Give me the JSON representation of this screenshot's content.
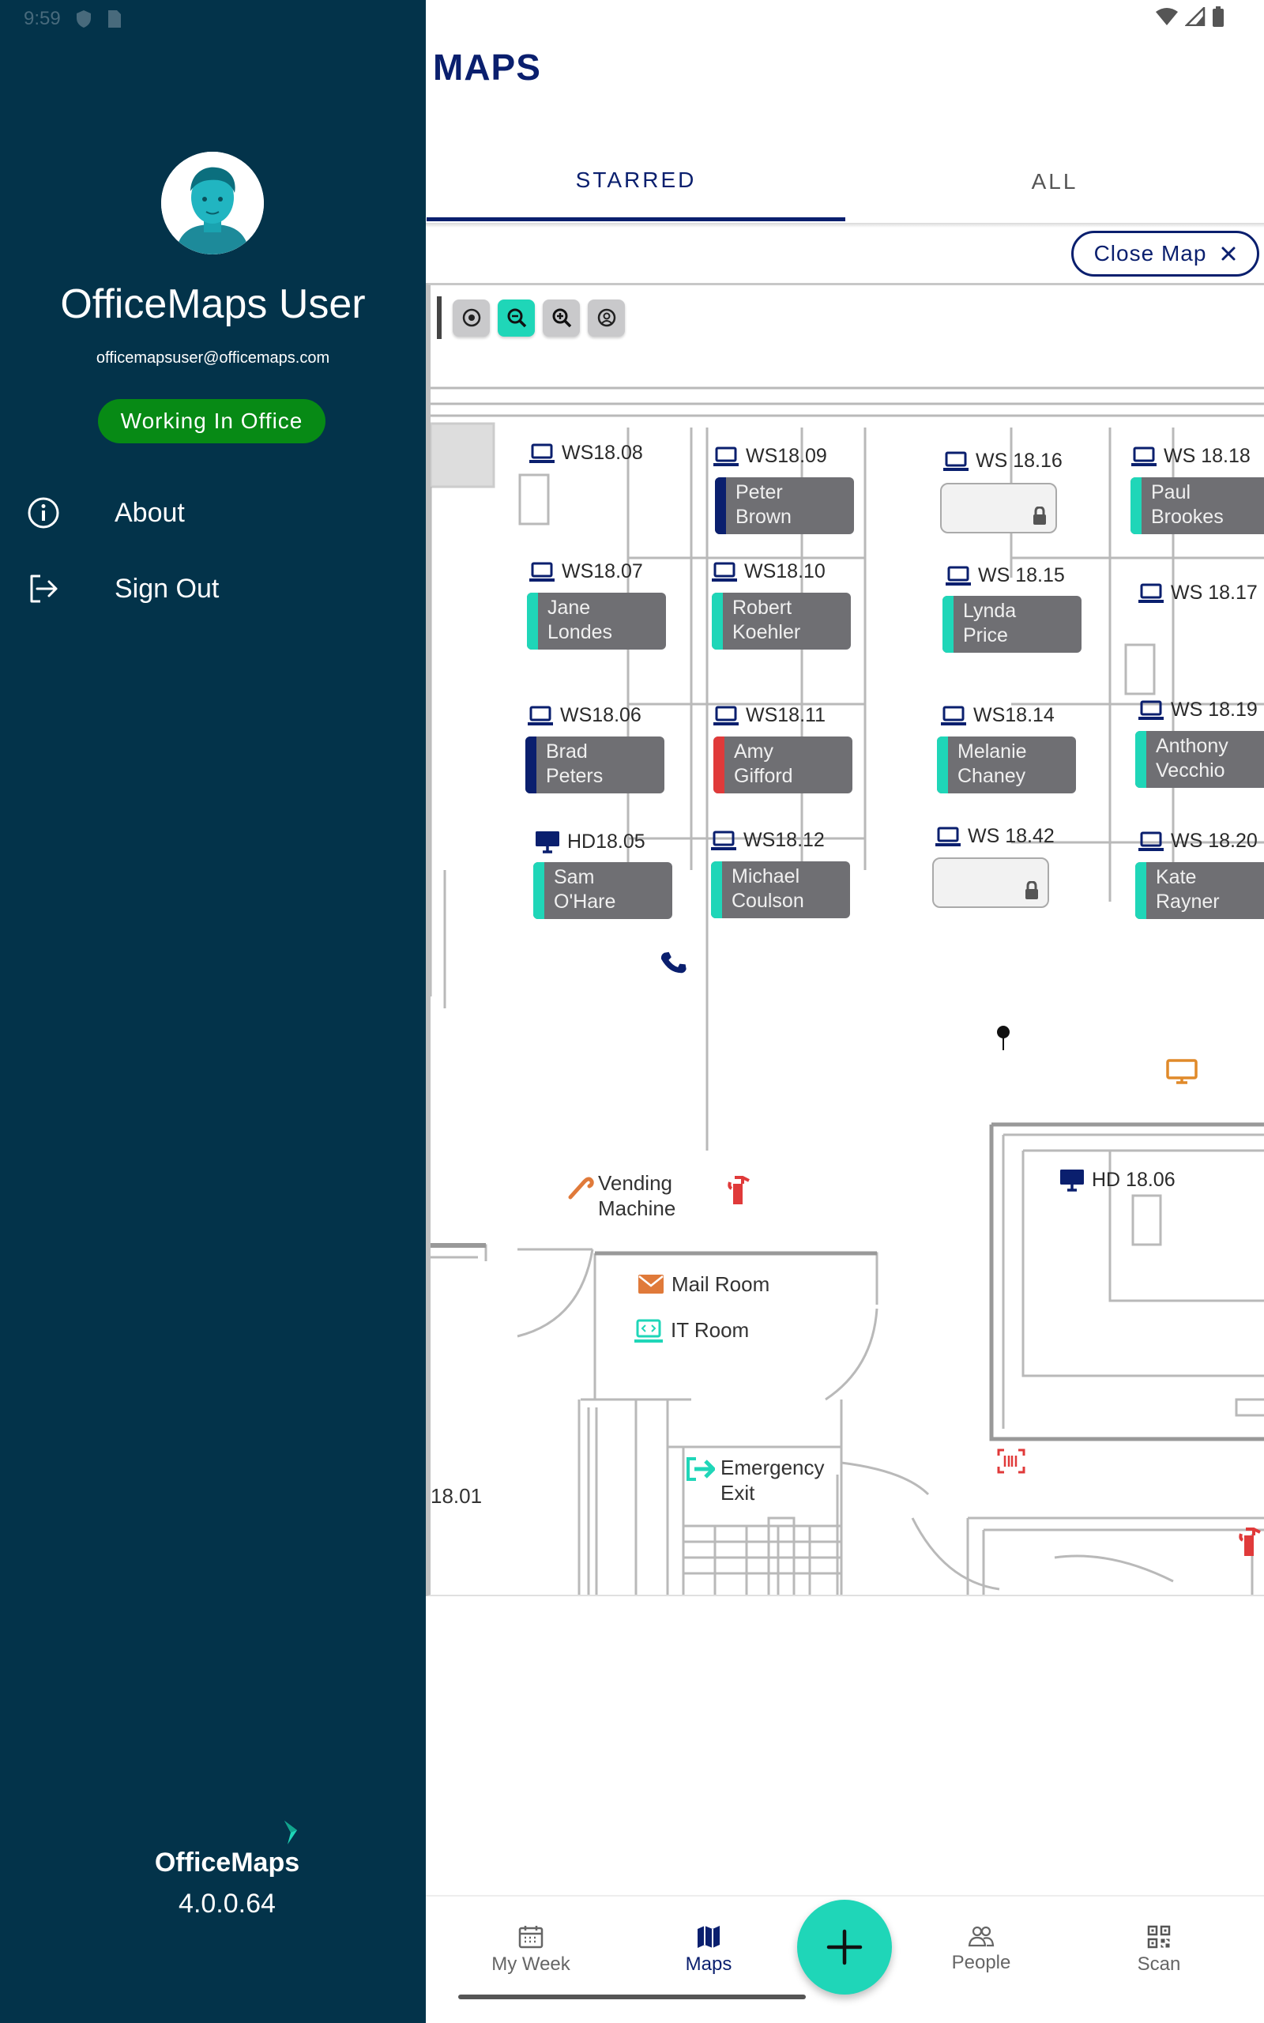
{
  "status_bar": {
    "time": "9:59"
  },
  "drawer": {
    "user_name": "OfficeMaps User",
    "user_email": "officemapsuser@officemaps.com",
    "status": "Working In Office",
    "menu": [
      {
        "label": "About",
        "icon": "info-icon"
      },
      {
        "label": "Sign Out",
        "icon": "sign-out-icon"
      }
    ],
    "brand": "OfficeMaps",
    "version": "4.0.0.64"
  },
  "header": {
    "title": "MAPS"
  },
  "tabs": [
    {
      "label": "STARRED",
      "active": true
    },
    {
      "label": "ALL",
      "active": false
    }
  ],
  "close_map": {
    "label": "Close Map"
  },
  "map": {
    "desks": [
      {
        "id": "WS18.08",
        "occupant": ""
      },
      {
        "id": "WS18.09",
        "occupant": "Peter\nBrown",
        "status_color": "#0a1f6e"
      },
      {
        "id": "WS 18.16",
        "occupant": "",
        "locked": true
      },
      {
        "id": "WS 18.18",
        "occupant": "Paul\nBrookes",
        "status_color": "#1fd6b8"
      },
      {
        "id": "WS18.07",
        "occupant": "Jane\nLondes",
        "status_color": "#1fd6b8"
      },
      {
        "id": "WS18.10",
        "occupant": "Robert\nKoehler",
        "status_color": "#1fd6b8"
      },
      {
        "id": "WS 18.15",
        "occupant": "Lynda\nPrice",
        "status_color": "#1fd6b8"
      },
      {
        "id": "WS 18.17",
        "occupant": ""
      },
      {
        "id": "WS18.06",
        "occupant": "Brad\nPeters",
        "status_color": "#0a1f6e"
      },
      {
        "id": "WS18.11",
        "occupant": "Amy\nGifford",
        "status_color": "#e03a3a"
      },
      {
        "id": "WS18.14",
        "occupant": "Melanie\nChaney",
        "status_color": "#1fd6b8"
      },
      {
        "id": "WS 18.19",
        "occupant": "Anthony\nVecchio",
        "status_color": "#1fd6b8"
      },
      {
        "id": "HD18.05",
        "occupant": "Sam\nO'Hare",
        "status_color": "#1fd6b8"
      },
      {
        "id": "WS18.12",
        "occupant": "Michael\nCoulson",
        "status_color": "#1fd6b8"
      },
      {
        "id": "WS 18.42",
        "occupant": "",
        "locked": true
      },
      {
        "id": "WS 18.20",
        "occupant": "Kate\nRayner",
        "status_color": "#1fd6b8"
      },
      {
        "id": "HD 18.06",
        "occupant": ""
      }
    ],
    "places": {
      "vending": "Vending\nMachine",
      "mail_room": "Mail Room",
      "it_room": "IT Room",
      "emergency_exit": "Emergency\nExit",
      "room_1801": "18.01"
    }
  },
  "bottom_nav": [
    {
      "label": "My Week",
      "icon": "calendar-icon",
      "active": false
    },
    {
      "label": "Maps",
      "icon": "map-icon",
      "active": true
    },
    {
      "label": "People",
      "icon": "people-icon",
      "active": false
    },
    {
      "label": "Scan",
      "icon": "qr-code-icon",
      "active": false
    }
  ]
}
